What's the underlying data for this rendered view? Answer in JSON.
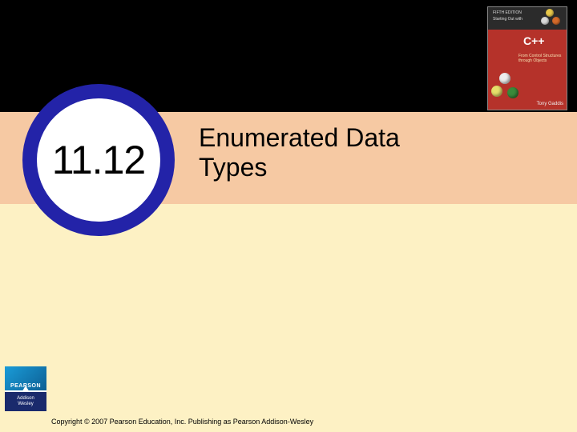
{
  "section_number": "11.12",
  "title_line1": "Enumerated Data",
  "title_line2": "Types",
  "copyright": "Copyright © 2007 Pearson Education, Inc. Publishing as Pearson Addison-Wesley",
  "book": {
    "edition": "FIFTH EDITION",
    "series": "Starting Out with",
    "lang": "C++",
    "subtitle": "From Control Structures\nthrough Objects",
    "author": "Tony Gaddis"
  },
  "publisher": {
    "name": "PEARSON",
    "imprint1": "Addison",
    "imprint2": "Wesley"
  }
}
